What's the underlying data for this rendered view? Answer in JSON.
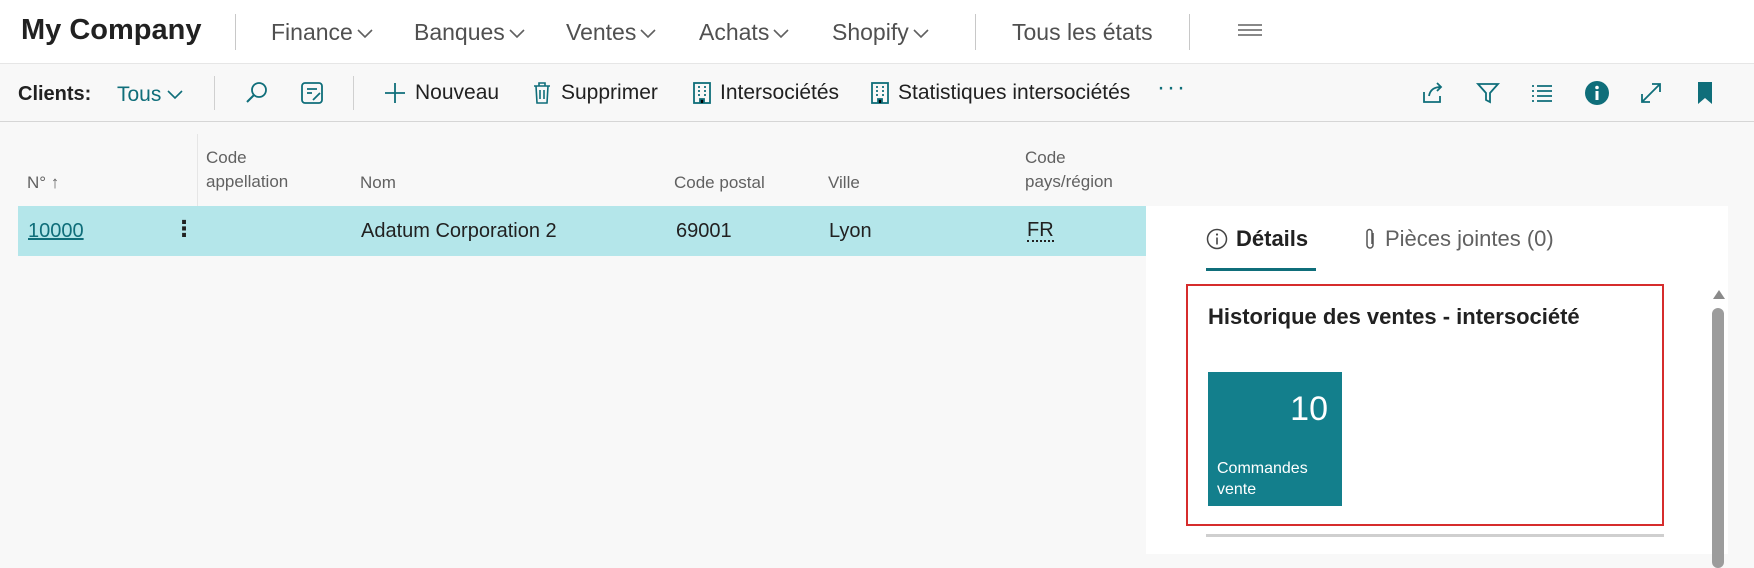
{
  "app": {
    "company": "My Company"
  },
  "nav": {
    "items": [
      "Finance",
      "Banques",
      "Ventes",
      "Achats",
      "Shopify"
    ],
    "all_reports": "Tous les états"
  },
  "actionbar": {
    "label": "Clients:",
    "filter": "Tous",
    "new": "Nouveau",
    "delete": "Supprimer",
    "intercompany": "Intersociétés",
    "ic_stats": "Statistiques intersociétés",
    "more": "···"
  },
  "table": {
    "headers": {
      "no": "N° ↑",
      "code_line1": "Code",
      "code_line2": "appellation",
      "name": "Nom",
      "postal": "Code postal",
      "city": "Ville",
      "country_line1": "Code",
      "country_line2": "pays/région"
    },
    "rows": [
      {
        "no": "10000",
        "code": "",
        "name": "Adatum Corporation 2",
        "postal": "69001",
        "city": "Lyon",
        "country": "FR"
      }
    ]
  },
  "pane": {
    "tabs": {
      "details": "Détails",
      "attachments": "Pièces jointes (0)"
    },
    "card": {
      "title": "Historique des ventes - intersociété",
      "cue_value": "10",
      "cue_label": "Commandes vente"
    }
  },
  "colors": {
    "accent": "#0f6e7a",
    "cue": "#137f8c",
    "row_selected": "#b4e6ea",
    "highlight_border": "#d62c2c"
  }
}
